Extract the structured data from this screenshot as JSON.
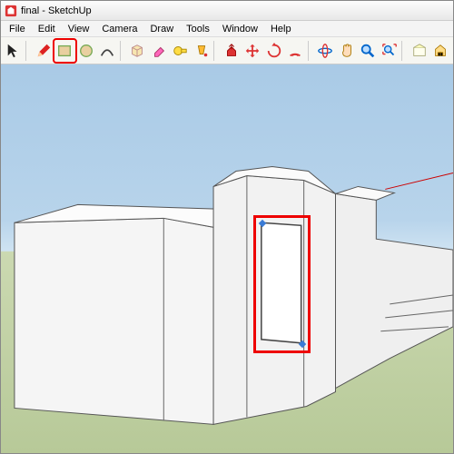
{
  "title": "final - SketchUp",
  "menu": {
    "file": "File",
    "edit": "Edit",
    "view": "View",
    "camera": "Camera",
    "draw": "Draw",
    "tools": "Tools",
    "window": "Window",
    "help": "Help"
  },
  "toolbar": {
    "select": "Select",
    "line": "Line",
    "rectangle": "Rectangle",
    "circle": "Circle",
    "arc": "Arc",
    "make_component": "Make Component",
    "eraser": "Eraser",
    "tape": "Tape Measure",
    "paint": "Paint Bucket",
    "pushpull": "Push/Pull",
    "move": "Move",
    "rotate": "Rotate",
    "offset": "Offset",
    "orbit": "Orbit",
    "pan": "Pan",
    "zoom": "Zoom",
    "zoom_extents": "Zoom Extents",
    "add_location": "Add Location",
    "get_models": "Get Models"
  },
  "highlights": {
    "active_tool": "rectangle",
    "rectangle_on_face": true
  }
}
